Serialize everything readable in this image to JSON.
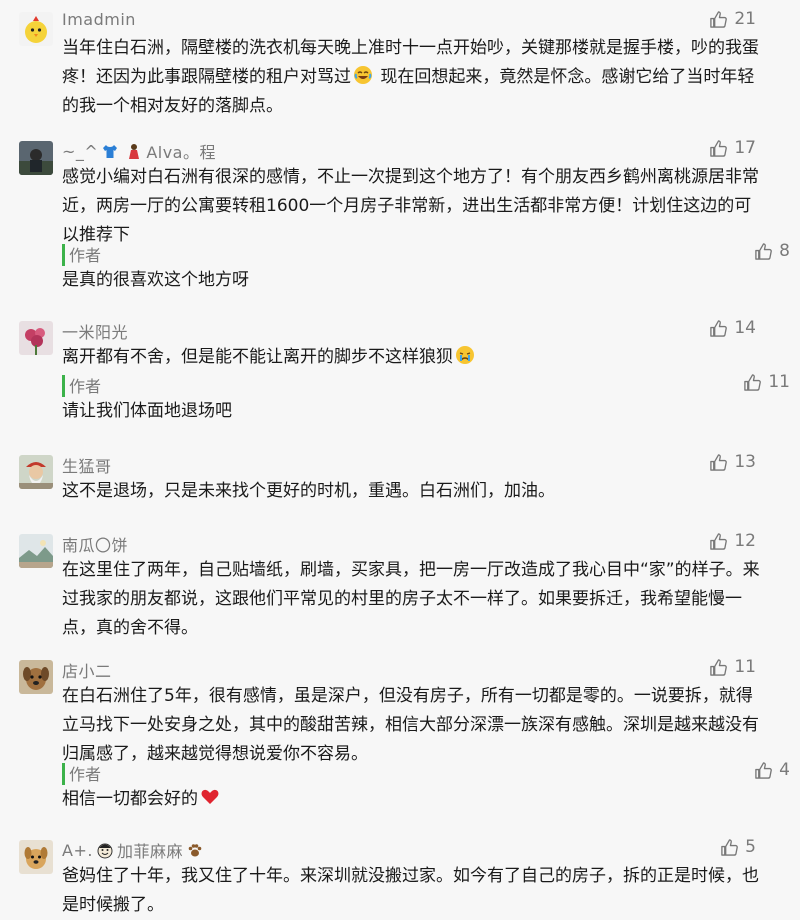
{
  "like_icon": "thumbs-up-outline-icon",
  "comments": [
    {
      "user": "Imadmin",
      "avatar": "chick-avatar",
      "likes": "21",
      "text_before": "当年住白石洲，隔壁楼的洗衣机每天晚上准时十一点开始吵，关键那楼就是握手楼，吵的我蛋疼！还因为此事跟隔壁楼的租户对骂过",
      "emoji": "laugh-tears-emoji",
      "text_after": " 现在回想起来，竟然是怀念。感谢它给了当时年轻的我一个相对友好的落脚点。"
    },
    {
      "user_parts": [
        "~_^",
        "Alva。程"
      ],
      "user_icons": [
        "tshirt-icon",
        "woman-icon"
      ],
      "avatar": "photo-avatar",
      "likes": "17",
      "text": "感觉小编对白石洲有很深的感情，不止一次提到这个地方了！有个朋友西乡鹤州离桃源居非常近，两房一厅的公寓要转租1600一个月房子非常新，进出生活都非常方便！计划住这边的可以推荐下",
      "reply": {
        "author": "作者",
        "likes": "8",
        "text": "是真的很喜欢这个地方呀"
      }
    },
    {
      "user": "一米阳光",
      "avatar": "flower-avatar",
      "likes": "14",
      "text_before": "离开都有不舍，但是能不能让离开的脚步不这样狼狈",
      "emoji": "crying-face-emoji",
      "text_after": "",
      "reply": {
        "author": "作者",
        "likes": "11",
        "text": "请让我们体面地退场吧"
      }
    },
    {
      "user": "生猛哥",
      "avatar": "elder-avatar",
      "likes": "13",
      "text": "这不是退场，只是未来找个更好的时机，重遇。白石洲们，加油。"
    },
    {
      "user": "南瓜〇饼",
      "avatar": "landscape-avatar",
      "likes": "12",
      "text": "在这里住了两年，自己贴墙纸，刷墙，买家具，把一房一厅改造成了我心目中“家”的样子。来过我家的朋友都说，这跟他们平常见的村里的房子太不一样了。如果要拆迁，我希望能慢一点，真的舍不得。"
    },
    {
      "user": "店小二",
      "avatar": "dog-avatar",
      "likes": "11",
      "text": "在白石洲住了5年，很有感情，虽是深户，但没有房子，所有一切都是零的。一说要拆，就得立马找下一处安身之处，其中的酸甜苦辣，相信大部分深漂一族深有感触。深圳是越来越没有归属感了，越来越觉得想说爱你不容易。",
      "reply": {
        "author": "作者",
        "likes": "4",
        "text_before": "相信一切都会好的",
        "emoji": "red-heart-emoji"
      }
    },
    {
      "user_parts": [
        "A+.",
        "加菲麻麻"
      ],
      "user_icons": [
        "smile-face-icon",
        "paw-icon"
      ],
      "avatar": "dog2-avatar",
      "likes": "5",
      "text": "爸妈住了十年，我又住了十年。来深圳就没搬过家。如今有了自己的房子，拆的正是时候，也是时候搬了。"
    }
  ]
}
